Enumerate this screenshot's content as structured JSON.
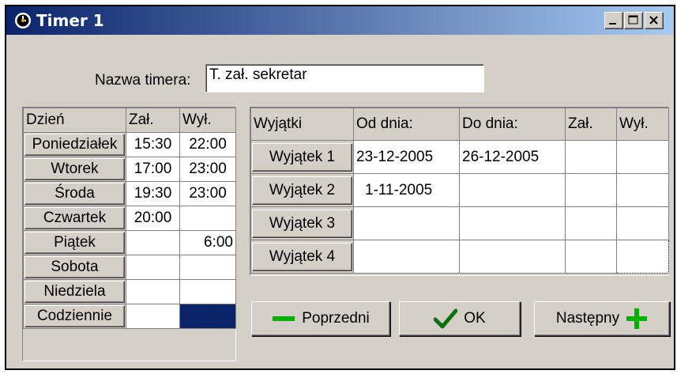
{
  "window": {
    "title": "Timer 1"
  },
  "form": {
    "name_label": "Nazwa timera:",
    "name_value": "T. zał. sekretar"
  },
  "days_table": {
    "headers": [
      "Dzień",
      "Zał.",
      "Wył."
    ],
    "rows": [
      {
        "day": "Poniedziałek",
        "on": "15:30",
        "off": "22:00"
      },
      {
        "day": "Wtorek",
        "on": "17:00",
        "off": "23:00"
      },
      {
        "day": "Środa",
        "on": "19:30",
        "off": "23:00"
      },
      {
        "day": "Czwartek",
        "on": "20:00",
        "off": ""
      },
      {
        "day": "Piątek",
        "on": "",
        "off": "6:00"
      },
      {
        "day": "Sobota",
        "on": "",
        "off": ""
      },
      {
        "day": "Niedziela",
        "on": "",
        "off": ""
      },
      {
        "day": "Codziennie",
        "on": "",
        "off": ""
      }
    ]
  },
  "exceptions_table": {
    "headers": [
      "Wyjątki",
      "Od dnia:",
      "Do dnia:",
      "Zał.",
      "Wył."
    ],
    "rows": [
      {
        "name": "Wyjątek 1",
        "from": "23-12-2005",
        "to": "26-12-2005",
        "on": "",
        "off": ""
      },
      {
        "name": "Wyjątek 2",
        "from": "1-11-2005",
        "to": "",
        "on": "",
        "off": ""
      },
      {
        "name": "Wyjątek 3",
        "from": "",
        "to": "",
        "on": "",
        "off": ""
      },
      {
        "name": "Wyjątek 4",
        "from": "",
        "to": "",
        "on": "",
        "off": ""
      }
    ]
  },
  "buttons": {
    "prev": "Poprzedni",
    "ok": "OK",
    "next": "Następny"
  },
  "colors": {
    "accent": "#0a246a",
    "selected_cell": "#0a2469",
    "minus": "#00b000",
    "plus": "#00b000",
    "check": "#107010"
  },
  "icons": {
    "title": "clock-icon",
    "prev": "minus-icon",
    "ok": "checkmark-icon",
    "next": "plus-icon"
  }
}
